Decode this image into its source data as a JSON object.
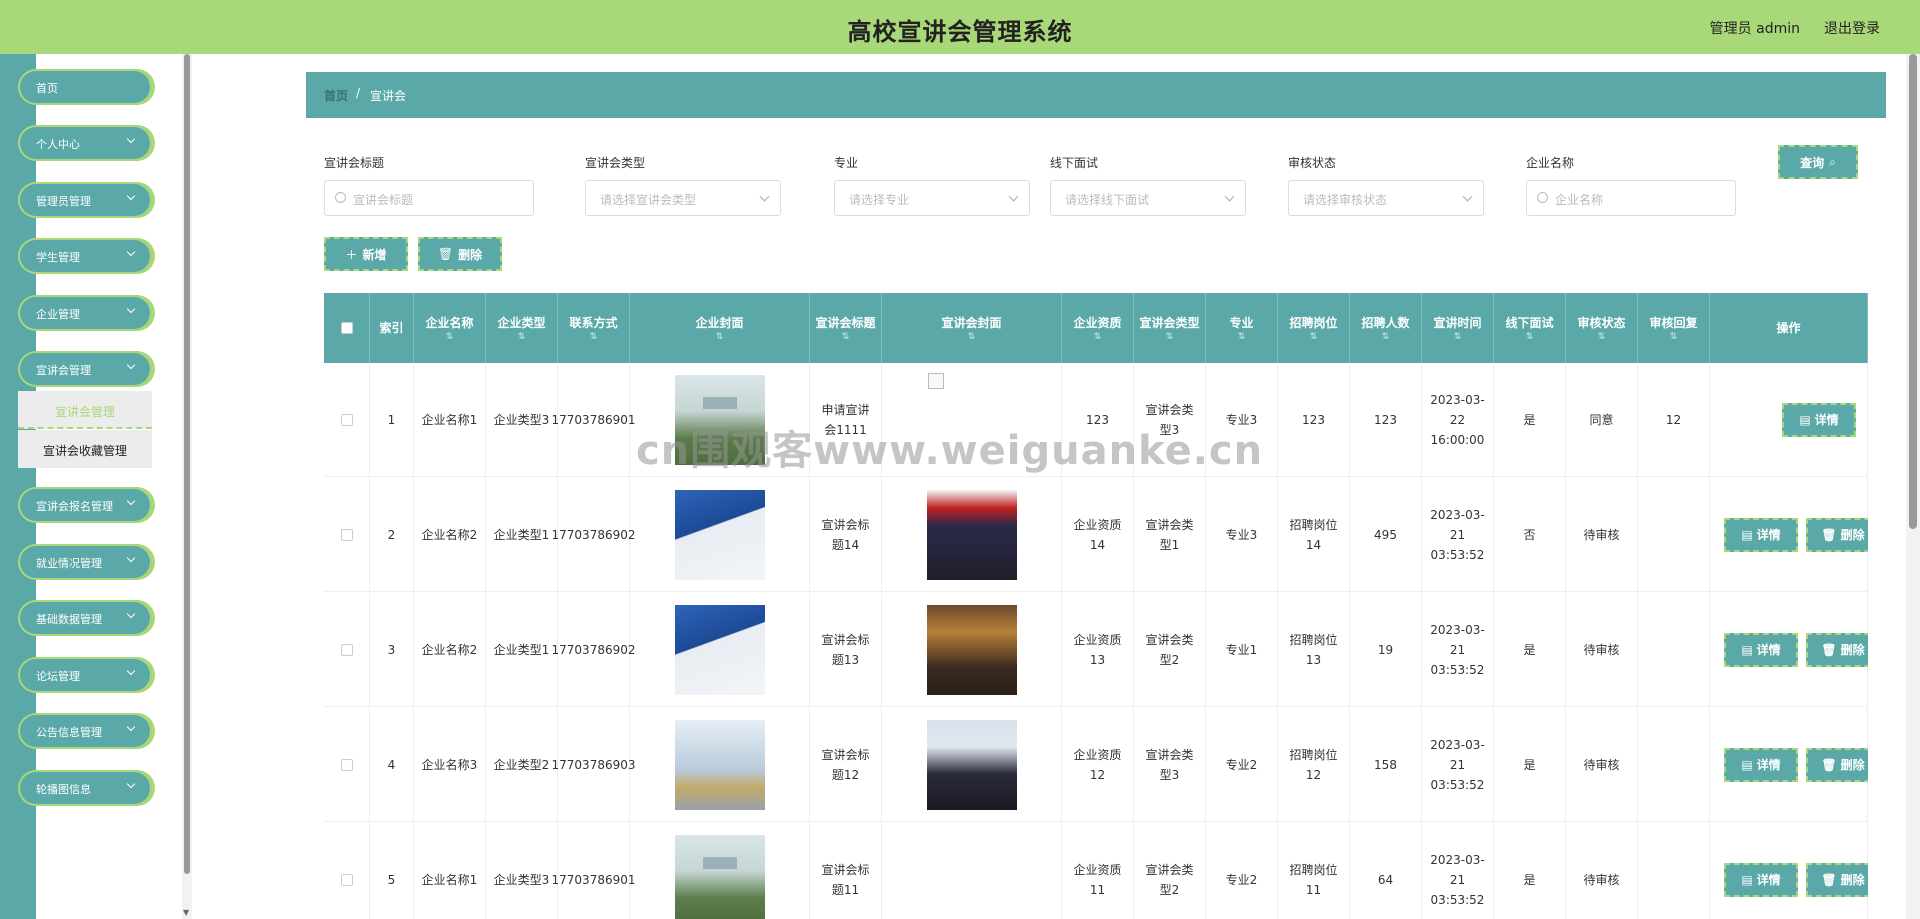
{
  "header": {
    "title": "高校宣讲会管理系统",
    "user": "管理员 admin",
    "logout": "退出登录"
  },
  "sidebar": {
    "items": [
      {
        "label": "首页",
        "chevron": false
      },
      {
        "label": "个人中心",
        "chevron": true
      },
      {
        "label": "管理员管理",
        "chevron": true
      },
      {
        "label": "学生管理",
        "chevron": true
      },
      {
        "label": "企业管理",
        "chevron": true
      },
      {
        "label": "宣讲会管理",
        "chevron": true
      },
      {
        "label": "宣讲会报名管理",
        "chevron": true
      },
      {
        "label": "就业情况管理",
        "chevron": true
      },
      {
        "label": "基础数据管理",
        "chevron": true
      },
      {
        "label": "论坛管理",
        "chevron": true
      },
      {
        "label": "公告信息管理",
        "chevron": true
      },
      {
        "label": "轮播图信息",
        "chevron": true
      }
    ],
    "submenu": [
      {
        "label": "宣讲会管理",
        "active": true
      },
      {
        "label": "宣讲会收藏管理",
        "active": false
      }
    ]
  },
  "breadcrumb": {
    "home": "首页",
    "sep": "/",
    "current": "宣讲会"
  },
  "filters": [
    {
      "label": "宣讲会标题",
      "placeholder": "宣讲会标题",
      "kind": "search"
    },
    {
      "label": "宣讲会类型",
      "placeholder": "请选择宣讲会类型",
      "kind": "select"
    },
    {
      "label": "专业",
      "placeholder": "请选择专业",
      "kind": "select"
    },
    {
      "label": "线下面试",
      "placeholder": "请选择线下面试",
      "kind": "select"
    },
    {
      "label": "审核状态",
      "placeholder": "请选择审核状态",
      "kind": "select"
    },
    {
      "label": "企业名称",
      "placeholder": "企业名称",
      "kind": "search"
    }
  ],
  "buttons": {
    "query": "查询",
    "add": "新增",
    "delete": "删除",
    "detail": "详情",
    "row_delete": "删除"
  },
  "table": {
    "columns": [
      "索引",
      "企业名称",
      "企业类型",
      "联系方式",
      "企业封面",
      "宣讲会标题",
      "宣讲会封面",
      "企业资质",
      "宣讲会类型",
      "专业",
      "招聘岗位",
      "招聘人数",
      "宣讲时间",
      "线下面试",
      "审核状态",
      "审核回复",
      "操作"
    ],
    "rows": [
      {
        "index": "1",
        "company": "企业名称1",
        "ctype": "企业类型3",
        "phone": "17703786901",
        "title": "申请宣讲会1111",
        "qual": "123",
        "stype": "宣讲会类型3",
        "major": "专业3",
        "post": "123",
        "count": "123",
        "time": "2023-03-22 16:00:00",
        "offline": "是",
        "status": "同意",
        "reply": "12",
        "cover": "img-a",
        "scover": "broken"
      },
      {
        "index": "2",
        "company": "企业名称2",
        "ctype": "企业类型1",
        "phone": "17703786902",
        "title": "宣讲会标题14",
        "qual": "企业资质14",
        "stype": "宣讲会类型1",
        "major": "专业3",
        "post": "招聘岗位14",
        "count": "495",
        "time": "2023-03-21 03:53:52",
        "offline": "否",
        "status": "待审核",
        "reply": "",
        "cover": "img-b",
        "scover": "img-d"
      },
      {
        "index": "3",
        "company": "企业名称2",
        "ctype": "企业类型1",
        "phone": "17703786902",
        "title": "宣讲会标题13",
        "qual": "企业资质13",
        "stype": "宣讲会类型2",
        "major": "专业1",
        "post": "招聘岗位13",
        "count": "19",
        "time": "2023-03-21 03:53:52",
        "offline": "是",
        "status": "待审核",
        "reply": "",
        "cover": "img-b",
        "scover": "img-e"
      },
      {
        "index": "4",
        "company": "企业名称3",
        "ctype": "企业类型2",
        "phone": "17703786903",
        "title": "宣讲会标题12",
        "qual": "企业资质12",
        "stype": "宣讲会类型3",
        "major": "专业2",
        "post": "招聘岗位12",
        "count": "158",
        "time": "2023-03-21 03:53:52",
        "offline": "是",
        "status": "待审核",
        "reply": "",
        "cover": "img-c",
        "scover": "img-f"
      },
      {
        "index": "5",
        "company": "企业名称1",
        "ctype": "企业类型3",
        "phone": "17703786901",
        "title": "宣讲会标题11",
        "qual": "企业资质11",
        "stype": "宣讲会类型2",
        "major": "专业2",
        "post": "招聘岗位11",
        "count": "64",
        "time": "2023-03-21 03:53:52",
        "offline": "是",
        "status": "待审核",
        "reply": "",
        "cover": "img-a",
        "scover": "none"
      }
    ]
  },
  "watermark": "cn围观客www.weiguanke.cn"
}
